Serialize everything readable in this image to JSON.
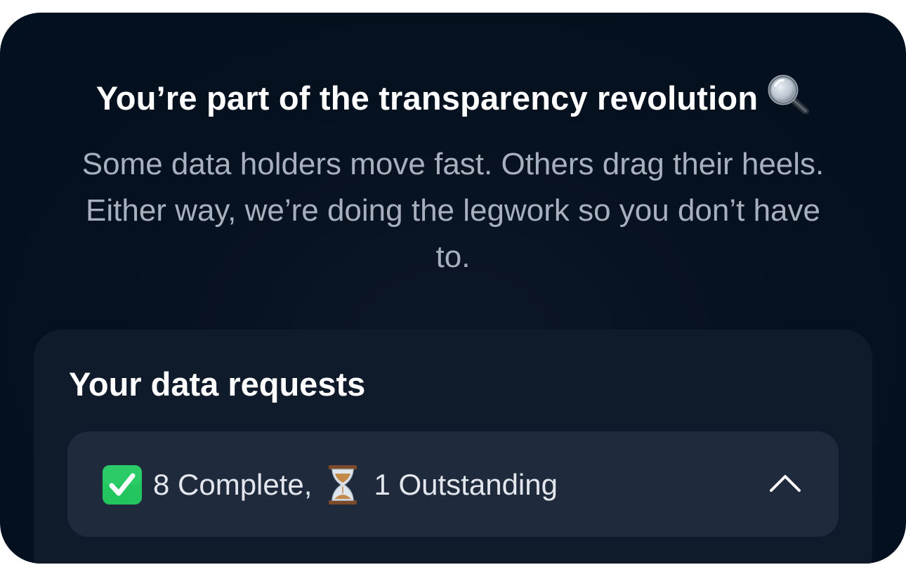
{
  "headline": {
    "text": "You’re part of the transparency revolution",
    "icon": "magnifying-glass-icon"
  },
  "subtext": "Some data holders move fast. Others drag their heels. Either way, we’re doing the legwork so you don’t have to.",
  "requests_card": {
    "title": "Your data requests",
    "summary": {
      "complete_icon": "check-mark-icon",
      "complete_label": "8 Complete,",
      "outstanding_icon": "hourglass-icon",
      "outstanding_label": "1 Outstanding",
      "toggle_icon": "chevron-up-icon"
    }
  },
  "colors": {
    "background": "#06111f",
    "card": "#0f1a2a",
    "row": "#1f2a3c",
    "check_green": "#22c55e",
    "subtext": "#a9b0bd"
  }
}
